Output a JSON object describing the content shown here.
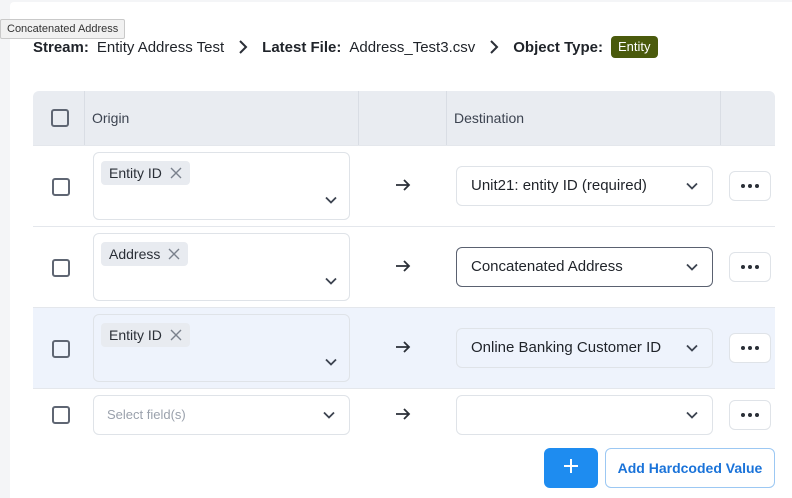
{
  "tooltip": "Concatenated Address",
  "breadcrumb": {
    "stream_label": "Stream:",
    "stream_value": "Entity Address Test",
    "file_label": "Latest File:",
    "file_value": "Address_Test3.csv",
    "type_label": "Object Type:",
    "type_badge": "Entity"
  },
  "table": {
    "headers": {
      "origin": "Origin",
      "destination": "Destination"
    },
    "rows": [
      {
        "origin_chip": "Entity ID",
        "destination": "Unit21: entity ID (required)"
      },
      {
        "origin_chip": "Address",
        "destination": "Concatenated Address"
      },
      {
        "origin_chip": "Entity ID",
        "destination": "Online Banking Customer ID"
      }
    ],
    "new_row": {
      "origin_placeholder": "Select field(s)",
      "destination": ""
    }
  },
  "actions": {
    "add_label": "+",
    "hardcoded_label": "Add Hardcoded Value"
  },
  "colors": {
    "badge": "#4a5a0c",
    "primary": "#1e8cf0",
    "row_highlight": "#eef3fc"
  },
  "icons": [
    "chevron-right-icon",
    "close-icon",
    "chevron-down-icon",
    "arrow-right-icon",
    "more-icon",
    "plus-icon"
  ]
}
